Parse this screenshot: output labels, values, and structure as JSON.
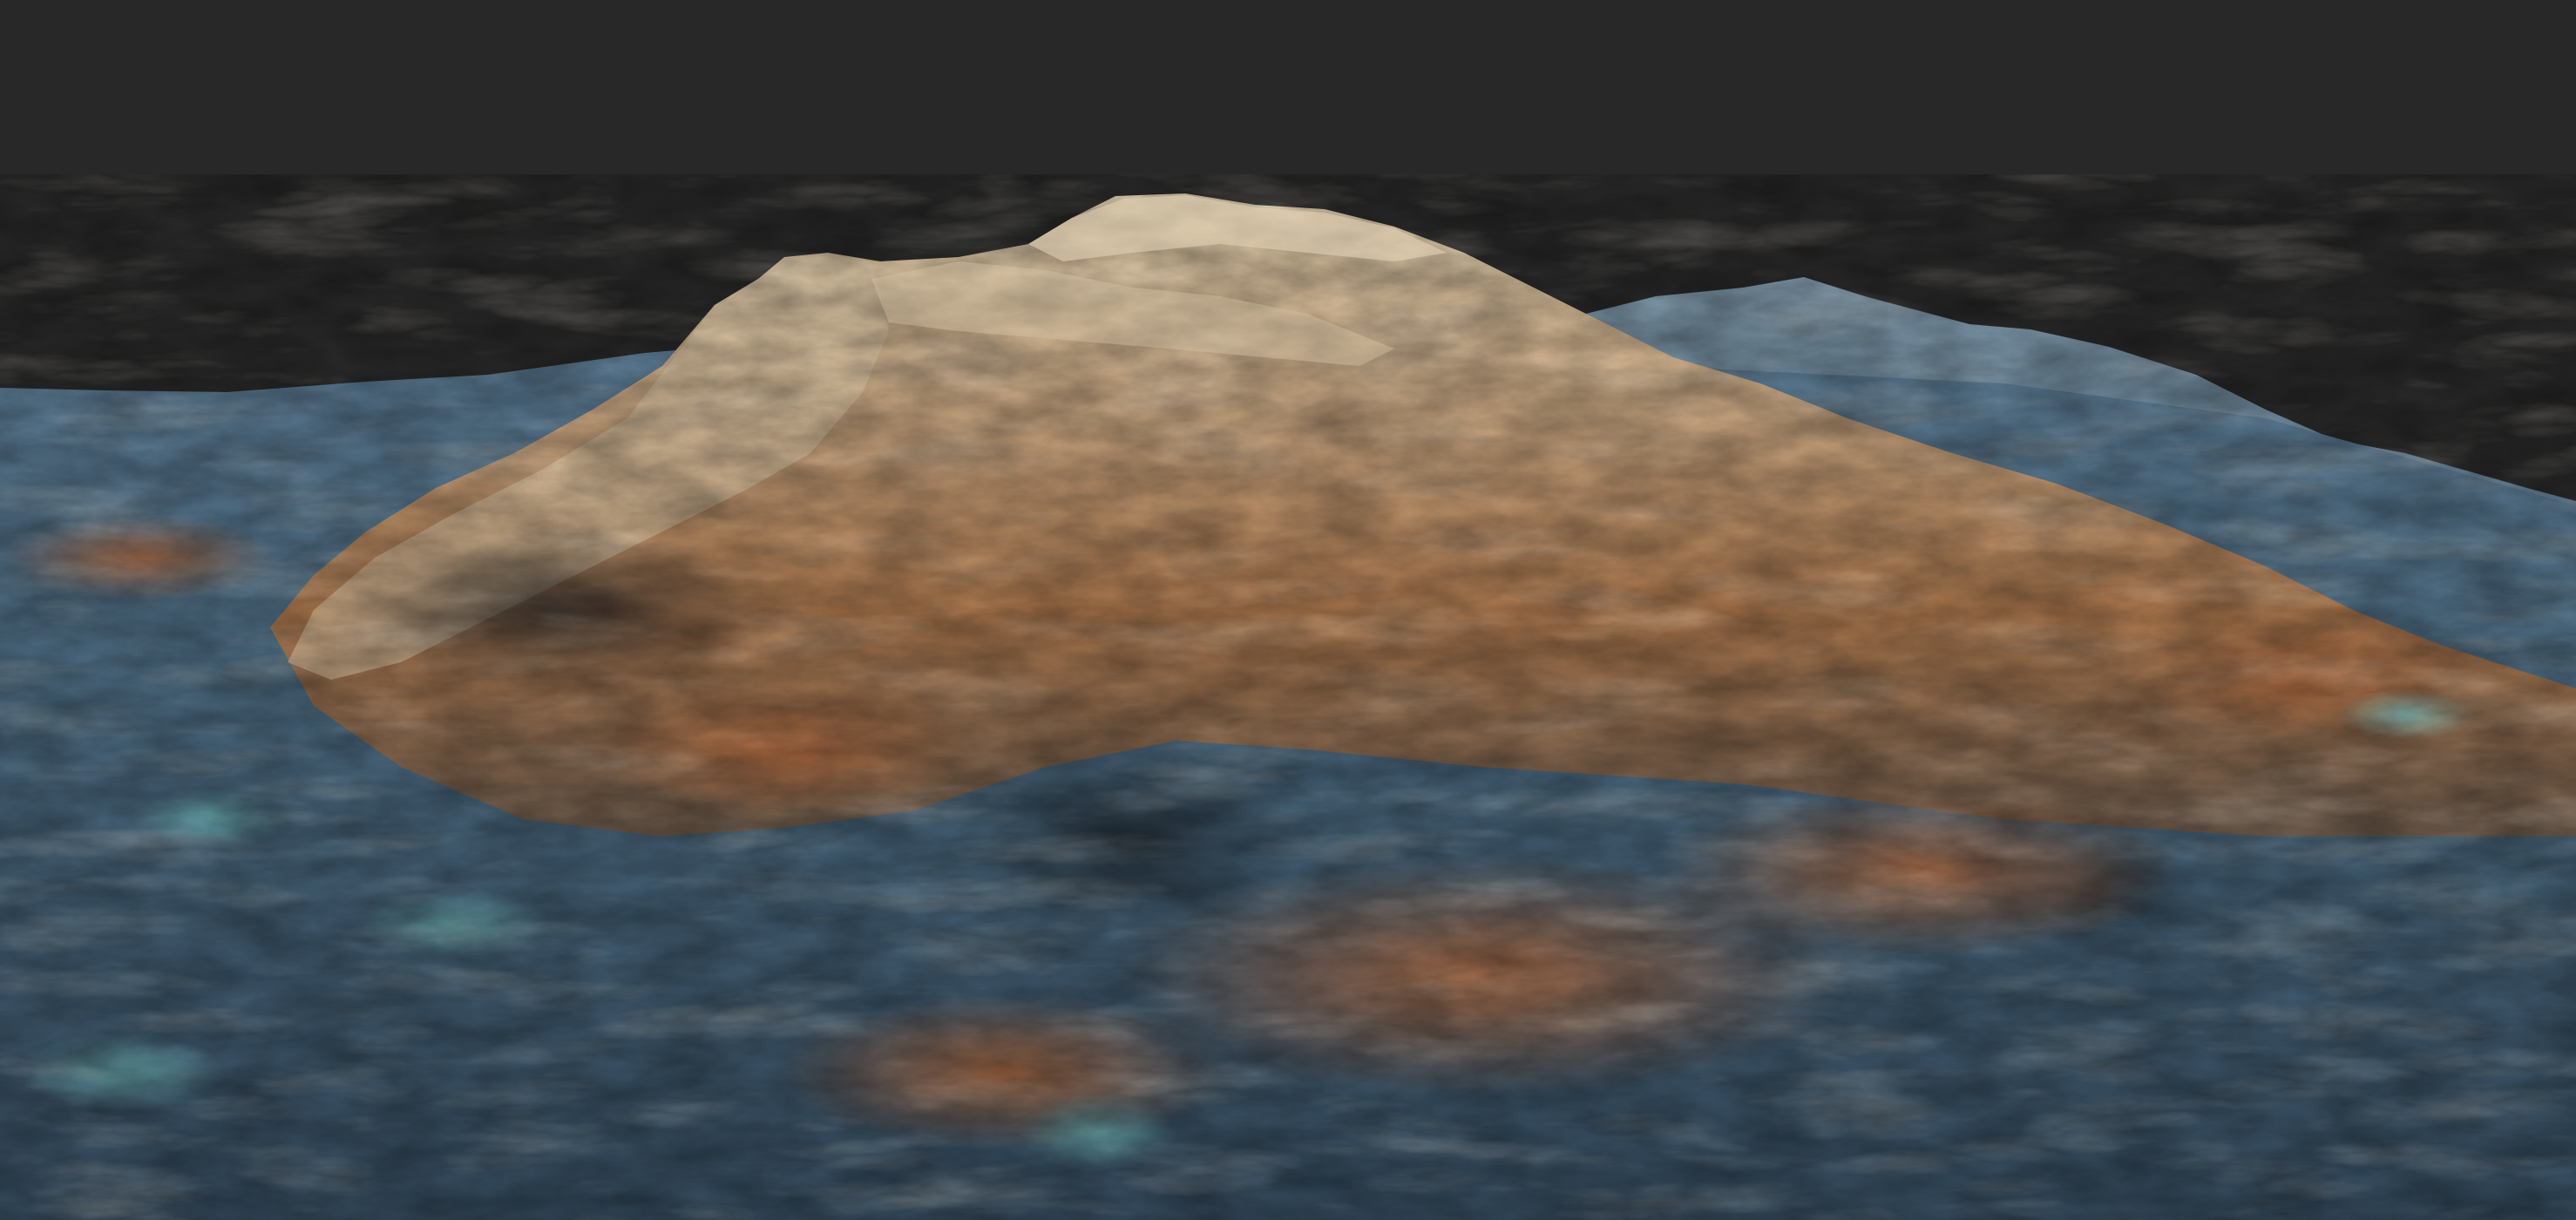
{
  "scene": {
    "subject": "terrain-render",
    "colors": {
      "background": "#272727",
      "sky": "#282828",
      "peak_highlight": "#d8c6a8",
      "rock_tan": "#b89a78",
      "rust_soil": "#a8643a",
      "slate_blue": "#4f6f86",
      "deep_blue": "#2e475a",
      "teal_pool": "#5fa3a8",
      "shadow": "#1e252c"
    }
  }
}
